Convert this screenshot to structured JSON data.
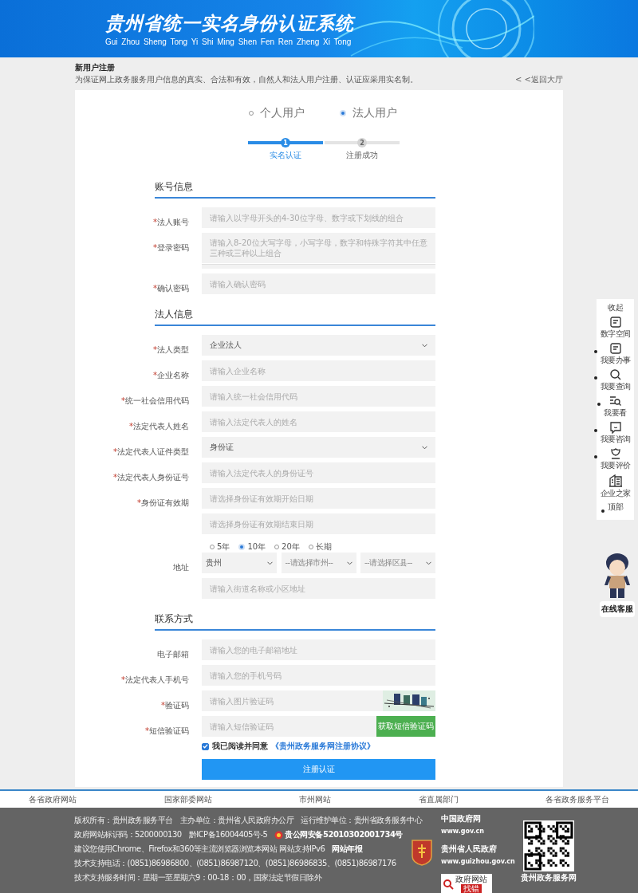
{
  "header": {
    "title": "贵州省统一实名身份认证系统",
    "subtitle": "Gui Zhou Sheng Tong Yi Shi Ming Shen Fen Ren Zheng Xi Tong"
  },
  "page": {
    "title": "新用户注册",
    "description": "为保证网上政务服务用户信息的真实、合法和有效，自然人和法人用户注册、认证应采用实名制。",
    "back_link": "< <返回大厅"
  },
  "user_types": [
    {
      "label": "个人用户",
      "selected": false
    },
    {
      "label": "法人用户",
      "selected": true
    }
  ],
  "steps": [
    {
      "number": "1",
      "label": "实名认证",
      "selected": true
    },
    {
      "number": "2",
      "label": "注册成功",
      "selected": false
    }
  ],
  "sections": [
    {
      "title": "账号信息",
      "fields": [
        {
          "kind": "input",
          "label": "法人账号",
          "mark": "*",
          "placeholder": "请输入以字母开头的4-30位字母、数字或下划线的组合"
        },
        {
          "kind": "password",
          "label": "登录密码",
          "mark": "*",
          "placeholder": "请输入8-20位大写字母，小写字母，数字和特殊字符其中任意三种或三种以上组合"
        },
        {
          "kind": "input",
          "label": "确认密码",
          "mark": "*",
          "placeholder": "请输入确认密码"
        }
      ]
    },
    {
      "title": "法人信息",
      "fields": [
        {
          "kind": "select",
          "label": "法人类型",
          "mark": "*",
          "value": "企业法人"
        },
        {
          "kind": "input",
          "label": "企业名称",
          "mark": "*",
          "placeholder": "请输入企业名称"
        },
        {
          "kind": "input",
          "label": "统一社会信用代码",
          "mark": "*",
          "placeholder": "请输入统一社会信用代码"
        },
        {
          "kind": "input",
          "label": "法定代表人姓名",
          "mark": "*",
          "placeholder": "请输入法定代表人的姓名"
        },
        {
          "kind": "select",
          "label": "法定代表人证件类型",
          "mark": "*",
          "value": "身份证"
        },
        {
          "kind": "input",
          "label": "法定代表人身份证号",
          "mark": "*",
          "placeholder": "请输入法定代表人的身份证号"
        },
        {
          "kind": "input",
          "label": "身份证有效期",
          "mark": "*",
          "placeholder": "请选择身份证有效期开始日期"
        },
        {
          "kind": "input",
          "placeholder": "请选择身份证有效期结束日期"
        },
        {
          "kind": "radios",
          "options": [
            {
              "label": "5年",
              "selected": false
            },
            {
              "label": "10年",
              "selected": true
            },
            {
              "label": "20年",
              "selected": false
            },
            {
              "label": "长期",
              "selected": false
            }
          ]
        },
        {
          "kind": "selects",
          "label": "地址",
          "options": [
            "贵州",
            "--请选择市州--",
            "--请选择区县--"
          ]
        },
        {
          "kind": "input",
          "placeholder": "请输入街道名称或小区地址"
        }
      ]
    },
    {
      "title": "联系方式",
      "fields": [
        {
          "kind": "input",
          "label": "电子邮箱",
          "placeholder": "请输入您的电子邮箱地址"
        },
        {
          "kind": "input",
          "label": "法定代表人手机号",
          "mark": "*",
          "placeholder": "请输入您的手机号码"
        },
        {
          "kind": "captcha",
          "label": "验证码",
          "mark": "*",
          "placeholder": "请输入图片验证码"
        },
        {
          "kind": "sms",
          "label": "短信验证码",
          "mark": "*",
          "placeholder": "请输入短信验证码",
          "button": "获取短信验证码"
        }
      ]
    }
  ],
  "agreement": {
    "checked": true,
    "text": "我已阅读并同意",
    "link": "《贵州政务服务网注册协议》"
  },
  "submit": "注册认证",
  "footer_links": [
    "各省政府网站",
    "国家部委网站",
    "市州网站",
    "省直属部门",
    "各省政务服务平台"
  ],
  "footer_lines": [
    [
      {
        "text": "版权所有：贵州政务服务平台",
        "bold": false
      },
      {
        "text": "主办单位：贵州省人民政府办公厅",
        "bold": false
      },
      {
        "text": "运行维护单位：贵州省政务服务中心",
        "bold": false
      }
    ],
    [
      {
        "text": "政府网站标识码：5200000130",
        "bold": false
      },
      {
        "text": "黔ICP备16004405号-5",
        "bold": false
      },
      {
        "text": "贵公网安备52010302001734号",
        "bold": true,
        "icon": true
      }
    ],
    [
      {
        "text": "建议您使用Chrome、Firefox和360等主流浏览器浏览本网站 网站支持IPv6",
        "bold": false
      },
      {
        "text": "网站年报",
        "bold": true
      }
    ],
    [
      {
        "text": "技术支持电话：(0851)86986800、(0851)86987120、(0851)86986835、(0851)86987176",
        "bold": false
      }
    ],
    [
      {
        "text": "技术支持服务时间：星期一至星期六9：00-18：00，国家法定节假日除外",
        "bold": false
      }
    ]
  ],
  "footer_sites": [
    {
      "name": "中国政府网",
      "url": "www.gov.cn"
    },
    {
      "name": "贵州省人民政府",
      "url": "www.guizhou.gov.cn"
    }
  ],
  "error_badge": [
    "政府网站",
    "找错"
  ],
  "qr_caption": "贵州政务服务网",
  "side_panel": {
    "collapse": "收起",
    "items": [
      {
        "label": "数字空间",
        "bullet": false
      },
      {
        "label": "我要办事",
        "bullet": true
      },
      {
        "label": "我要查询",
        "bullet": true
      },
      {
        "label": "我要看",
        "bullet": true
      },
      {
        "label": "我要咨询",
        "bullet": true
      },
      {
        "label": "我要评价",
        "bullet": true
      },
      {
        "label": "企业之家",
        "bullet": false
      },
      {
        "label": "顶部",
        "bullet": true
      }
    ],
    "service": "在线客服"
  }
}
